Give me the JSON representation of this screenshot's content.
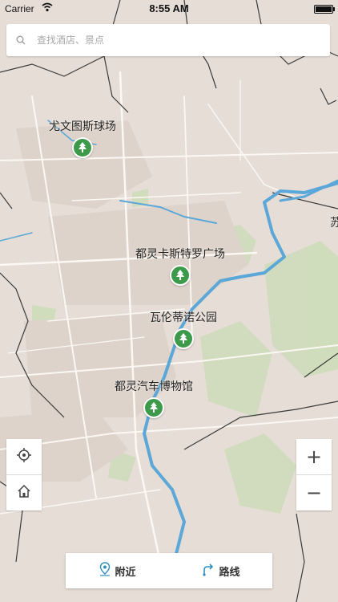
{
  "status_bar": {
    "carrier": "Carrier",
    "time": "8:55 AM",
    "battery_level": 1.0
  },
  "search": {
    "placeholder": "查找酒店、景点",
    "icon": "search-icon"
  },
  "map": {
    "edge_label": "苏",
    "pois": [
      {
        "name": "尤文图斯球场",
        "icon": "tree-icon"
      },
      {
        "name": "都灵卡斯特罗广场",
        "icon": "tree-icon"
      },
      {
        "name": "瓦伦蒂诺公园",
        "icon": "tree-icon"
      },
      {
        "name": "都灵汽车博物馆",
        "icon": "tree-icon"
      }
    ],
    "colors": {
      "land": "#e6ddd6",
      "river": "#5aa7d8",
      "road": "#fbf8f4",
      "border": "#3b3b3b",
      "park": "#c9d9b6",
      "poi_marker": "#3e9a4b"
    }
  },
  "controls": {
    "locate_icon": "crosshair-icon",
    "home_icon": "home-icon",
    "zoom_in": "+",
    "zoom_out": "−"
  },
  "bottom_bar": {
    "nearby_label": "附近",
    "nearby_icon": "location-pin-icon",
    "route_label": "路线",
    "route_icon": "route-icon"
  }
}
